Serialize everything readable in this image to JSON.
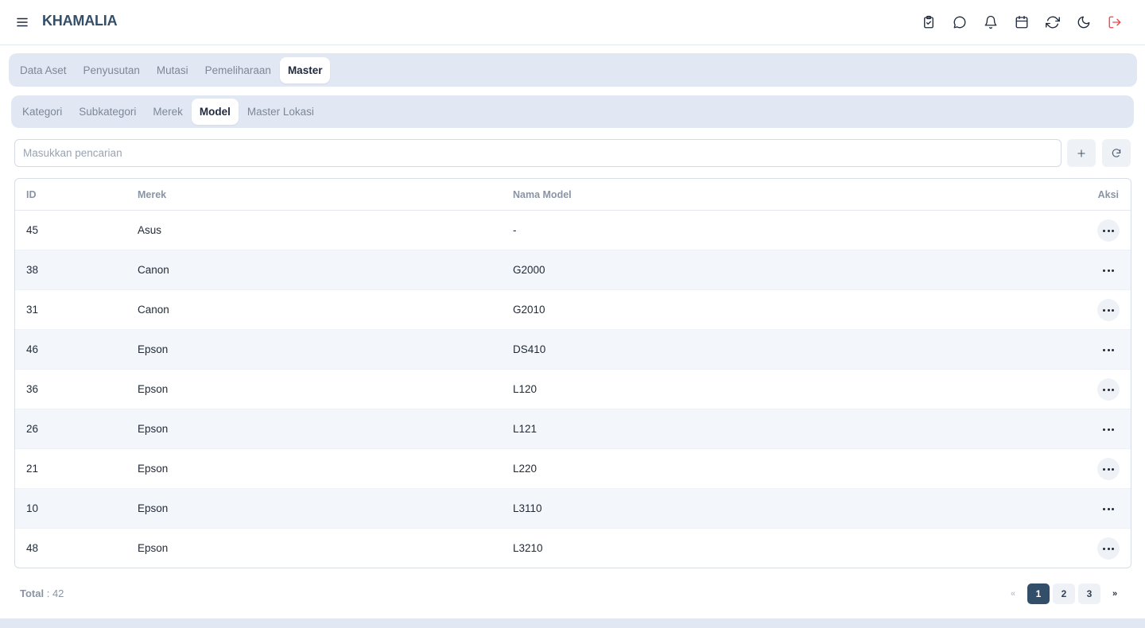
{
  "header": {
    "brand": "KHAMALIA",
    "icons": [
      "clipboard-check-icon",
      "chat-icon",
      "bell-icon",
      "calendar-icon",
      "sync-icon",
      "moon-icon",
      "logout-icon"
    ]
  },
  "main_tabs": [
    {
      "label": "Data Aset",
      "active": false
    },
    {
      "label": "Penyusutan",
      "active": false
    },
    {
      "label": "Mutasi",
      "active": false
    },
    {
      "label": "Pemeliharaan",
      "active": false
    },
    {
      "label": "Master",
      "active": true
    }
  ],
  "sub_tabs": [
    {
      "label": "Kategori",
      "active": false
    },
    {
      "label": "Subkategori",
      "active": false
    },
    {
      "label": "Merek",
      "active": false
    },
    {
      "label": "Model",
      "active": true
    },
    {
      "label": "Master Lokasi",
      "active": false
    }
  ],
  "search": {
    "placeholder": "Masukkan pencarian",
    "value": ""
  },
  "table": {
    "headers": {
      "id": "ID",
      "merek": "Merek",
      "model": "Nama Model",
      "aksi": "Aksi"
    },
    "rows": [
      {
        "id": "45",
        "merek": "Asus",
        "model": "-"
      },
      {
        "id": "38",
        "merek": "Canon",
        "model": "G2000"
      },
      {
        "id": "31",
        "merek": "Canon",
        "model": "G2010"
      },
      {
        "id": "46",
        "merek": "Epson",
        "model": "DS410"
      },
      {
        "id": "36",
        "merek": "Epson",
        "model": "L120"
      },
      {
        "id": "26",
        "merek": "Epson",
        "model": "L121"
      },
      {
        "id": "21",
        "merek": "Epson",
        "model": "L220"
      },
      {
        "id": "10",
        "merek": "Epson",
        "model": "L3110"
      },
      {
        "id": "48",
        "merek": "Epson",
        "model": "L3210"
      }
    ]
  },
  "footer": {
    "total_label": "Total",
    "total_value": ": 42",
    "pagination": {
      "prev": "«",
      "pages": [
        "1",
        "2",
        "3"
      ],
      "current": "1",
      "next": "»"
    }
  },
  "colors": {
    "brand": "#334e68",
    "accent": "#334e68",
    "tabbar_bg": "#e2e8f3",
    "logout": "#ef4444"
  }
}
